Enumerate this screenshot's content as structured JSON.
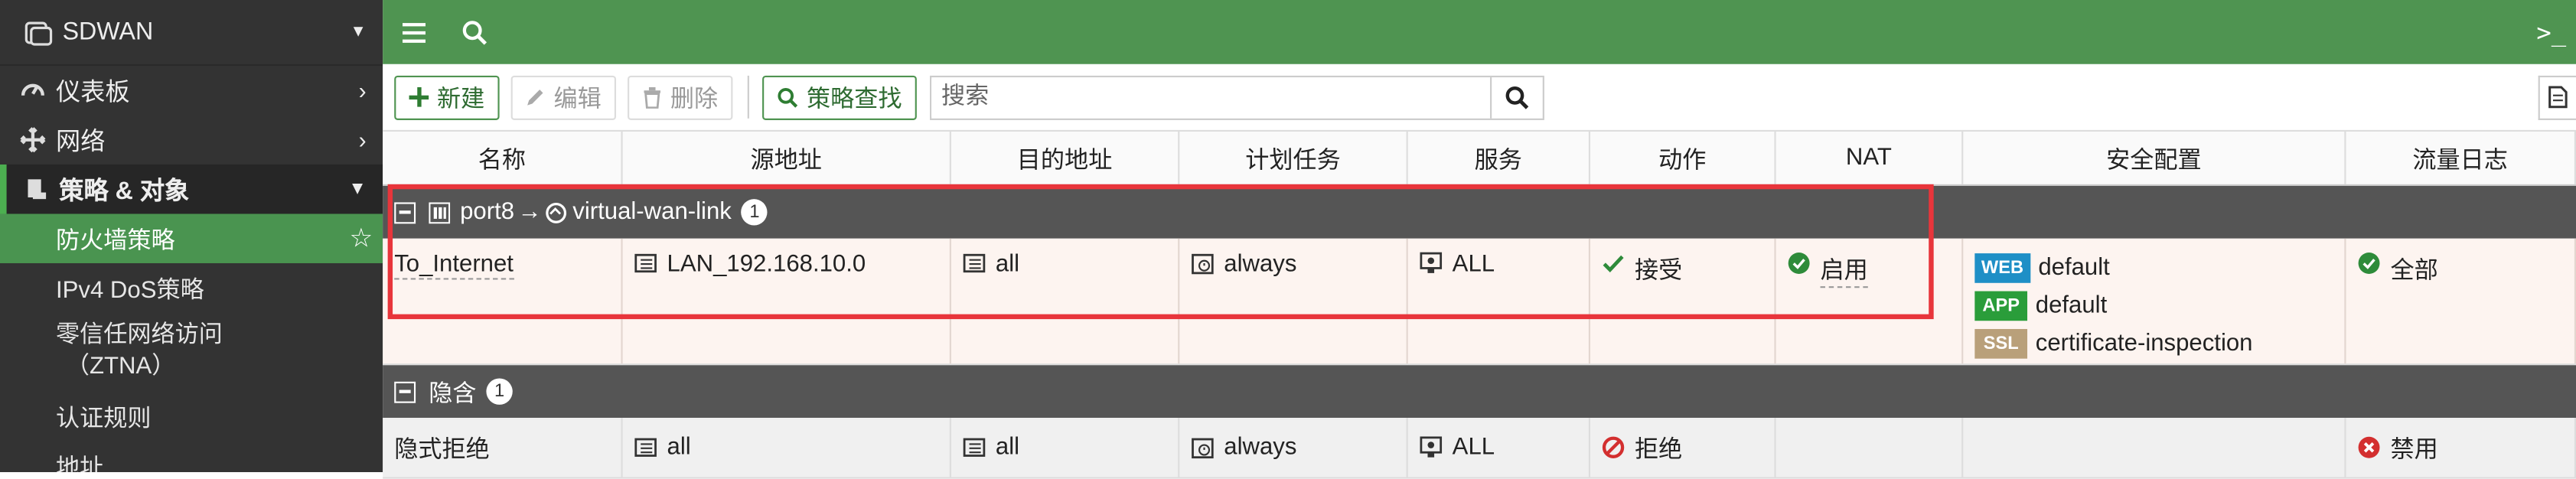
{
  "sidebar": {
    "device": "SDWAN",
    "items": [
      {
        "label": "仪表板",
        "icon": "dashboard-icon"
      },
      {
        "label": "网络",
        "icon": "network-icon"
      },
      {
        "label": "策略 & 对象",
        "icon": "policy-icon"
      }
    ],
    "sub_items": [
      {
        "label": "防火墙策略"
      },
      {
        "label": "IPv4 DoS策略"
      },
      {
        "label_line1": "零信任网络访问",
        "label_line2": "（ZTNA）"
      },
      {
        "label": "认证规则"
      },
      {
        "label": "地址"
      }
    ]
  },
  "toolbar": {
    "new_label": "新建",
    "edit_label": "编辑",
    "delete_label": "删除",
    "lookup_label": "策略查找",
    "search_placeholder": "搜索"
  },
  "table": {
    "columns": [
      "名称",
      "源地址",
      "目的地址",
      "计划任务",
      "服务",
      "动作",
      "NAT",
      "安全配置",
      "流量日志"
    ],
    "group1": {
      "src": "port8",
      "arrow": "→",
      "dst": "virtual-wan-link",
      "count": "1"
    },
    "policy": {
      "name": "To_Internet",
      "source": "LAN_192.168.10.0",
      "destination": "all",
      "schedule": "always",
      "service": "ALL",
      "action": "接受",
      "nat": "启用",
      "security": [
        {
          "tag": "WEB",
          "value": "default",
          "color": "#1e8fc6"
        },
        {
          "tag": "APP",
          "value": "default",
          "color": "#2a9d3a"
        },
        {
          "tag": "SSL",
          "value": "certificate-inspection",
          "color": "#b9a07a"
        }
      ],
      "log": "全部"
    },
    "group2": {
      "label": "隐含",
      "count": "1"
    },
    "implicit": {
      "name": "隐式拒绝",
      "source": "all",
      "destination": "all",
      "schedule": "always",
      "service": "ALL",
      "action": "拒绝",
      "log": "禁用"
    }
  },
  "colors": {
    "topbar": "#4f9451",
    "sidebar": "#333333",
    "accent_red": "#e8353b"
  }
}
